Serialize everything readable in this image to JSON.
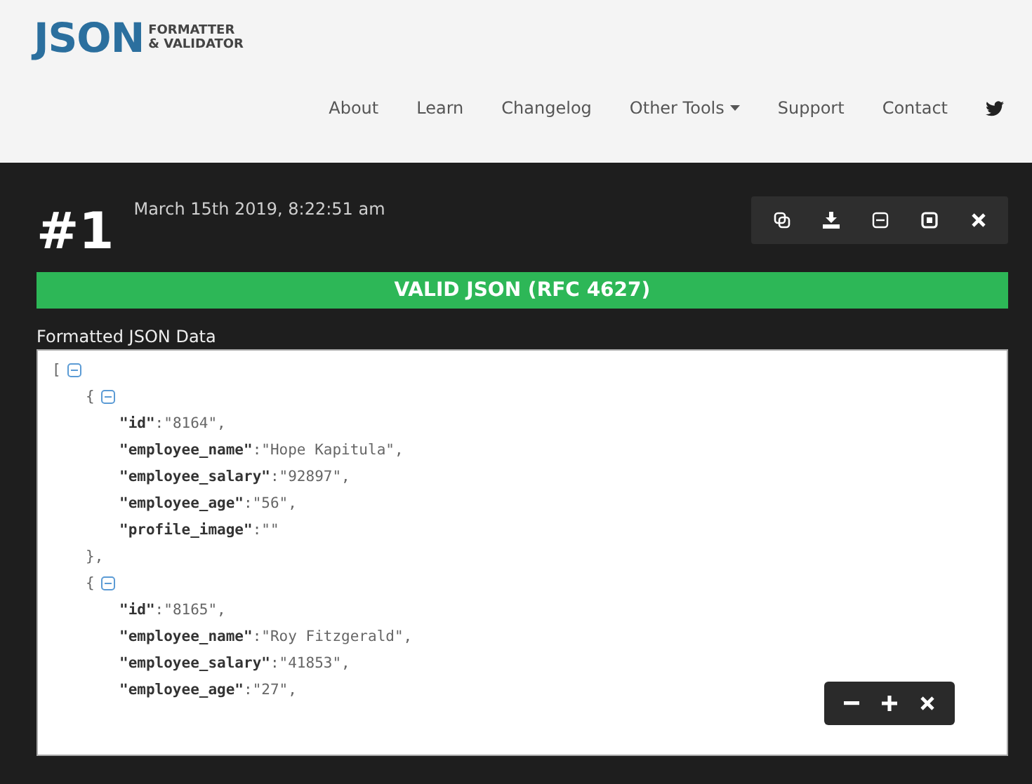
{
  "header": {
    "logo": {
      "main": "JSON",
      "line_1": "FORMATTER",
      "line_2": "& VALIDATOR"
    },
    "nav": [
      {
        "label": "About",
        "kind": "link"
      },
      {
        "label": "Learn",
        "kind": "link"
      },
      {
        "label": "Changelog",
        "kind": "link"
      },
      {
        "label": "Other Tools",
        "kind": "dropdown"
      },
      {
        "label": "Support",
        "kind": "link"
      },
      {
        "label": "Contact",
        "kind": "link"
      },
      {
        "kind": "twitter"
      }
    ]
  },
  "result": {
    "number": "#1",
    "timestamp": "March 15th 2019, 8:22:51 am",
    "status": "VALID JSON (RFC 4627)",
    "valid": true,
    "section_label": "Formatted JSON Data",
    "tree": {
      "open": "[",
      "expanded": true,
      "children": [
        {
          "open": "{",
          "expanded": true,
          "close": "},",
          "children": [
            {
              "key": "\"id\"",
              "rest": ":\"8164\","
            },
            {
              "key": "\"employee_name\"",
              "rest": ":\"Hope Kapitula\","
            },
            {
              "key": "\"employee_salary\"",
              "rest": ":\"92897\","
            },
            {
              "key": "\"employee_age\"",
              "rest": ":\"56\","
            },
            {
              "key": "\"profile_image\"",
              "rest": ":\"\""
            }
          ]
        },
        {
          "open": "{",
          "expanded": true,
          "children": [
            {
              "key": "\"id\"",
              "rest": ":\"8165\","
            },
            {
              "key": "\"employee_name\"",
              "rest": ":\"Roy Fitzgerald\","
            },
            {
              "key": "\"employee_salary\"",
              "rest": ":\"41853\","
            },
            {
              "key": "\"employee_age\"",
              "rest": ":\"27\","
            }
          ]
        }
      ]
    }
  }
}
